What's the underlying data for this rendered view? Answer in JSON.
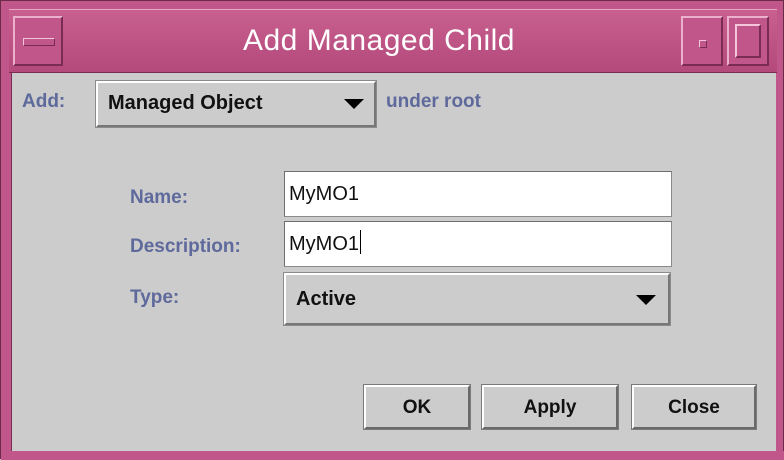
{
  "window": {
    "title": "Add Managed Child"
  },
  "add_row": {
    "label": "Add:",
    "selected": "Managed Object",
    "suffix": "under root"
  },
  "form": {
    "name": {
      "label": "Name:",
      "value": "MyMO1"
    },
    "description": {
      "label": "Description:",
      "value": "MyMO1"
    },
    "type": {
      "label": "Type:",
      "selected": "Active"
    }
  },
  "buttons": {
    "ok": "OK",
    "apply": "Apply",
    "close": "Close"
  },
  "colors": {
    "frame": "#c0568a",
    "label": "#5f6a9c",
    "background": "#cccccc"
  }
}
